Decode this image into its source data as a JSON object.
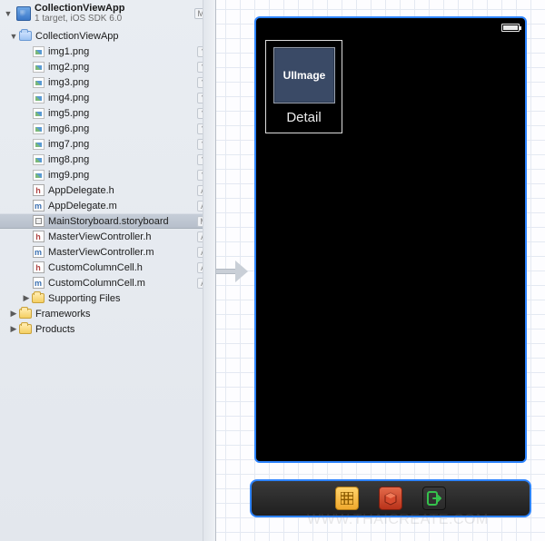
{
  "project": {
    "title": "CollectionViewApp",
    "subtitle": "1 target, iOS SDK 6.0",
    "badge": "M"
  },
  "tree": {
    "root": {
      "label": "CollectionViewApp"
    },
    "images": [
      {
        "label": "img1.png",
        "badge": "?"
      },
      {
        "label": "img2.png",
        "badge": "?"
      },
      {
        "label": "img3.png",
        "badge": "?"
      },
      {
        "label": "img4.png",
        "badge": "?"
      },
      {
        "label": "img5.png",
        "badge": "?"
      },
      {
        "label": "img6.png",
        "badge": "?"
      },
      {
        "label": "img7.png",
        "badge": "?"
      },
      {
        "label": "img8.png",
        "badge": "?"
      },
      {
        "label": "img9.png",
        "badge": "?"
      }
    ],
    "sources": [
      {
        "label": "AppDelegate.h",
        "kind": "h",
        "badge": "A"
      },
      {
        "label": "AppDelegate.m",
        "kind": "m",
        "badge": "A"
      },
      {
        "label": "MainStoryboard.storyboard",
        "kind": "sb",
        "badge": "M",
        "selected": true
      },
      {
        "label": "MasterViewController.h",
        "kind": "h",
        "badge": "A"
      },
      {
        "label": "MasterViewController.m",
        "kind": "m",
        "badge": "A"
      },
      {
        "label": "CustomColumnCell.h",
        "kind": "h",
        "badge": "A"
      },
      {
        "label": "CustomColumnCell.m",
        "kind": "m",
        "badge": "A"
      }
    ],
    "folders": [
      {
        "label": "Supporting Files"
      },
      {
        "label": "Frameworks"
      },
      {
        "label": "Products"
      }
    ]
  },
  "scene": {
    "cell_image_label": "UIImage",
    "cell_text": "Detail"
  },
  "watermark": "WWW.THAICREATE.COM"
}
